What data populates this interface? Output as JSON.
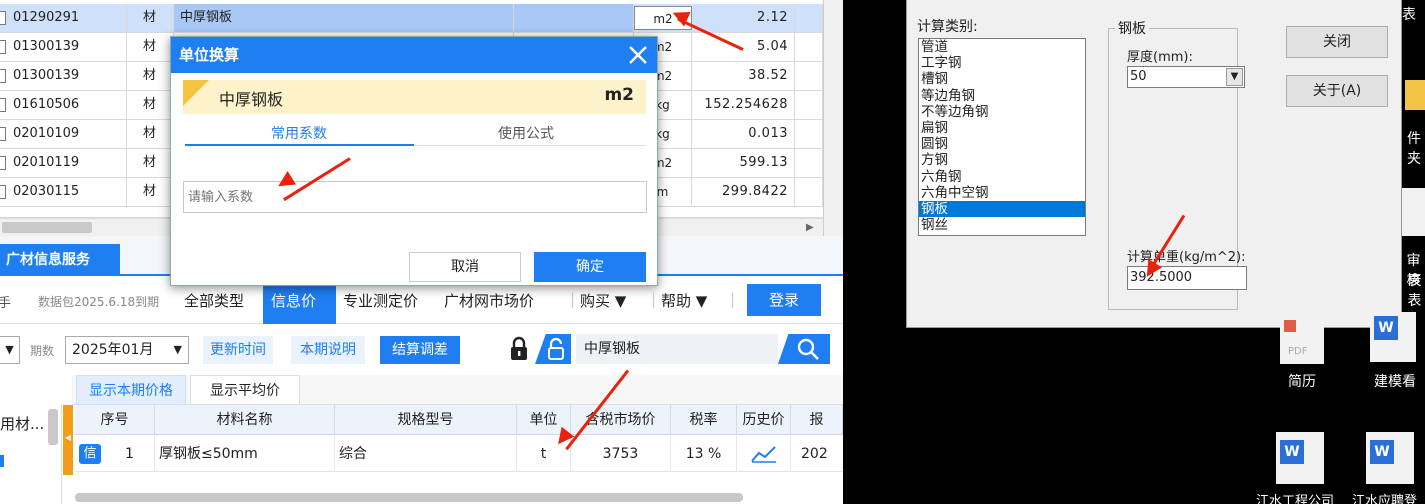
{
  "table": {
    "rows": [
      {
        "code": "01290291",
        "type": "材",
        "name": "中厚钢板",
        "unit": "m2",
        "value": "2.12",
        "selected": true
      },
      {
        "code": "01300139",
        "type": "材",
        "name": "",
        "unit": "m2",
        "value": "5.04"
      },
      {
        "code": "01300139",
        "type": "材",
        "name": "",
        "unit": "m2",
        "value": "38.52"
      },
      {
        "code": "01610506",
        "type": "材",
        "name": "",
        "unit": "kg",
        "value": "152.254628"
      },
      {
        "code": "02010109",
        "type": "材",
        "name": "",
        "unit": "kg",
        "value": "0.013"
      },
      {
        "code": "02010119",
        "type": "材",
        "name": "",
        "unit": "m2",
        "value": "599.13"
      },
      {
        "code": "02030115",
        "type": "材",
        "name": "",
        "unit": "m",
        "value": "299.8422"
      }
    ]
  },
  "unit_dialog": {
    "title": "单位换算",
    "material_name": "中厚钢板",
    "material_unit": "m2",
    "tab_common": "常用系数",
    "tab_formula": "使用公式",
    "placeholder": "请输入系数",
    "cancel": "取消",
    "ok": "确定"
  },
  "panel": {
    "tab_title": "广材信息服务",
    "package_text": "数据包2025.6.18到期",
    "nav": [
      "全部类型",
      "信息价",
      "专业测定价",
      "广材网市场价",
      "购买 ▼",
      "帮助 ▼"
    ],
    "login": "登录",
    "period_label": "期数",
    "period_value": "2025年01月",
    "update_time": "更新时间",
    "period_desc": "本期说明",
    "settle": "结算调差",
    "search_value": "中厚钢板",
    "subtab_current": "显示本期价格",
    "subtab_avg": "显示平均价",
    "side_label": "用材...",
    "columns": [
      "序号",
      "材料名称",
      "规格型号",
      "单位",
      "含税市场价",
      "税率",
      "历史价",
      "报"
    ],
    "row": {
      "badge": "信",
      "index": "1",
      "name": "厚钢板≤50mm",
      "spec": "综合",
      "unit": "t",
      "price": "3753",
      "tax": "13 %",
      "report": "202"
    }
  },
  "calc_dialog": {
    "category_label": "计算类别:",
    "categories": [
      "管道",
      "工字钢",
      "槽钢",
      "等边角钢",
      "不等边角钢",
      "扁钢",
      "圆钢",
      "方钢",
      "六角钢",
      "六角中空钢",
      "钢板",
      "钢丝"
    ],
    "selected_index": 10,
    "group_label": "钢板",
    "thickness_label": "厚度(mm):",
    "thickness_value": "50",
    "weight_label": "计算单重(kg/m^2):",
    "weight_value": "392.5000",
    "close": "关闭",
    "about": "关于(A)"
  },
  "desktop": {
    "icons": [
      "简历",
      "建模看",
      "江水工程公司",
      "江水应聘登"
    ],
    "edge_texts": [
      "表",
      "件夹",
      "审核",
      "衰表"
    ]
  }
}
